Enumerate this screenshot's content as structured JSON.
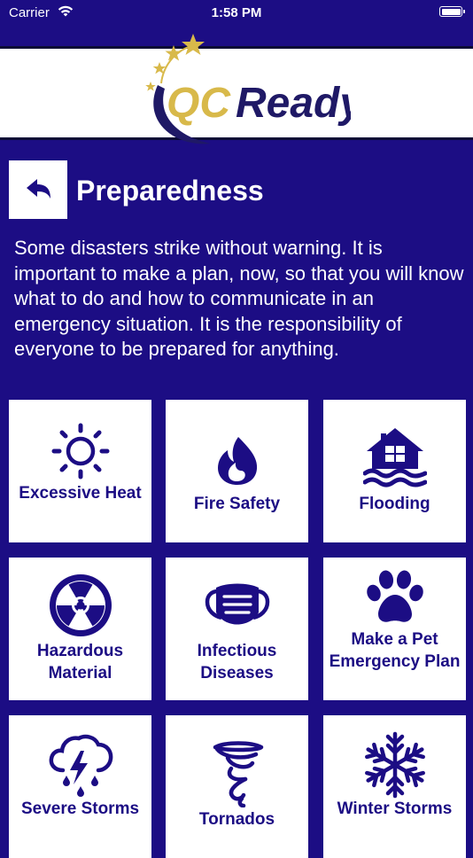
{
  "status_bar": {
    "carrier": "Carrier",
    "time": "1:58 PM"
  },
  "logo": {
    "brand_part_1": "QC",
    "brand_part_2": "Ready"
  },
  "header": {
    "title": "Preparedness"
  },
  "intro": "Some disasters strike without warning.  It is important to make a plan, now, so that you will know what to do and how to communicate in an emergency situation.  It is the responsibility of everyone to be prepared for anything.",
  "tiles": [
    {
      "label": "Excessive Heat",
      "icon": "sun-icon"
    },
    {
      "label": "Fire Safety",
      "icon": "flame-icon"
    },
    {
      "label": "Flooding",
      "icon": "flooded-house-icon"
    },
    {
      "label": "Hazardous Material",
      "icon": "radiation-icon"
    },
    {
      "label": "Infectious Diseases",
      "icon": "face-mask-icon"
    },
    {
      "label": "Make a Pet Emergency Plan",
      "icon": "paw-icon"
    },
    {
      "label": "Severe Storms",
      "icon": "storm-cloud-icon"
    },
    {
      "label": "Tornados",
      "icon": "tornado-icon"
    },
    {
      "label": "Winter Storms",
      "icon": "snowflake-icon"
    }
  ],
  "colors": {
    "background": "#1c0d84",
    "tile": "#ffffff",
    "logo_gold": "#d8b94a",
    "logo_navy": "#1f1966"
  }
}
